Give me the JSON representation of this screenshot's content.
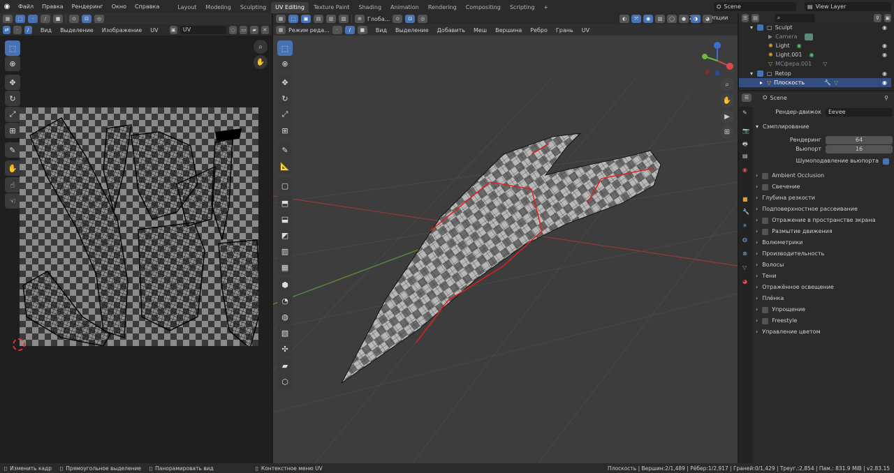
{
  "topbar": {
    "menu": [
      "Файл",
      "Правка",
      "Рендеринг",
      "Окно",
      "Справка"
    ],
    "tabs": [
      "Layout",
      "Modeling",
      "Sculpting",
      "UV Editing",
      "Texture Paint",
      "Shading",
      "Animation",
      "Rendering",
      "Compositing",
      "Scripting"
    ],
    "active_tab": "UV Editing",
    "add_tab": "+",
    "scene": "Scene",
    "view_layer": "View Layer"
  },
  "uv_editor": {
    "menu": [
      "Вид",
      "Выделение",
      "Изображение",
      "UV"
    ],
    "image_name": "UV"
  },
  "viewport": {
    "mode": "Режим реда...",
    "menu": [
      "Вид",
      "Выделение",
      "Добавить",
      "Меш",
      "Вершина",
      "Ребро",
      "Грань",
      "UV"
    ],
    "orientation": "Глоба...",
    "options": "Опции",
    "axes": [
      "X",
      "Y",
      "Z"
    ]
  },
  "outliner": {
    "search_placeholder": "",
    "rows": [
      {
        "label": "Sculpt",
        "type": "collection"
      },
      {
        "label": "Camera",
        "type": "object",
        "dim": true
      },
      {
        "label": "Light",
        "type": "object"
      },
      {
        "label": "Light.001",
        "type": "object"
      },
      {
        "label": "МСфера.001",
        "type": "object",
        "dim": true
      },
      {
        "label": "Retop",
        "type": "collection"
      },
      {
        "label": "Плоскость",
        "type": "object",
        "selected": true
      }
    ]
  },
  "properties": {
    "context": "Scene",
    "render_engine_label": "Рендер-движок",
    "render_engine": "Eevee",
    "sampling_title": "Сэмплирование",
    "render_label": "Рендеринг",
    "render_value": "64",
    "viewport_label": "Вьюпорт",
    "viewport_value": "16",
    "denoise_label": "Шумоподавление вьюпорта",
    "panels": [
      {
        "label": "Ambient Occlusion",
        "checkbox": true
      },
      {
        "label": "Свечение",
        "checkbox": true
      },
      {
        "label": "Глубина резкости",
        "checkbox": false
      },
      {
        "label": "Подповерхностное рассеивание",
        "checkbox": false
      },
      {
        "label": "Отражение в пространстве экрана",
        "checkbox": true
      },
      {
        "label": "Размытие движения",
        "checkbox": true
      },
      {
        "label": "Волюметрики",
        "checkbox": false
      },
      {
        "label": "Производительность",
        "checkbox": false
      },
      {
        "label": "Волосы",
        "checkbox": false
      },
      {
        "label": "Тени",
        "checkbox": false
      },
      {
        "label": "Отражённое освещение",
        "checkbox": false
      },
      {
        "label": "Плёнка",
        "checkbox": false
      },
      {
        "label": "Упрощение",
        "checkbox": true
      },
      {
        "label": "Freestyle",
        "checkbox": true
      },
      {
        "label": "Управление цветом",
        "checkbox": false
      }
    ]
  },
  "statusbar": {
    "hint1": "Изменить кадр",
    "hint2": "Прямоугольное выделение",
    "hint3": "Панорамировать вид",
    "hint4": "Контекстное меню UV",
    "stats": "Плоскость | Вершин:2/1,489 | Рёбер:1/2,917 | Граней:0/1,429 | Треуг.:2,854 | Пам.: 831.9 MiB | v2.83.15"
  },
  "colors": {
    "accent": "#4772b3",
    "selected_row": "#334d80",
    "seam": "#e02020"
  }
}
